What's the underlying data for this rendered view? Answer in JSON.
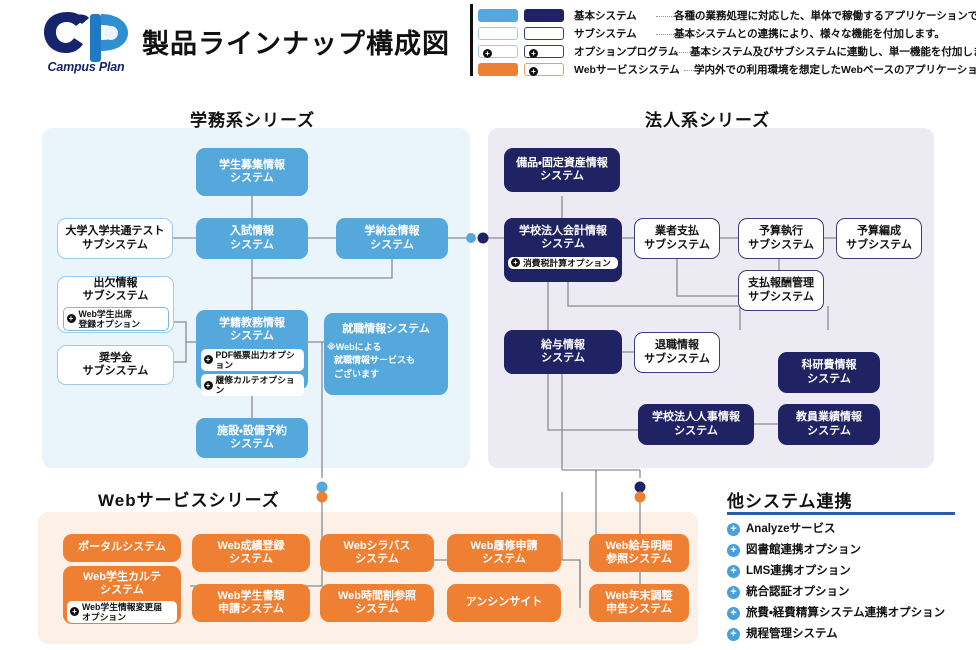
{
  "header": {
    "logo_name": "Campus Plan",
    "logo_icon": "campus-plan-logo",
    "title": "製品ラインナップ構成図"
  },
  "legend": {
    "rows": [
      {
        "label": "基本システム",
        "description": "各種の業務処理に対応した、単体で稼働するアプリケーションです。",
        "swatch1": "#55a8dc",
        "swatch2": "#1f2263",
        "type": "filled"
      },
      {
        "label": "サブシステム",
        "description": "基本システムとの連携により、様々な機能を付加します。",
        "swatch1": "#ffffff",
        "swatch2": "#ffffff",
        "type": "outline"
      },
      {
        "label": "オプションプログラム",
        "description": "基本システム及びサブシステムに連動し、単一機能を付加します。",
        "swatch1": "#ffffff",
        "swatch2": "#ffffff",
        "type": "option",
        "plus": "+"
      },
      {
        "label": "Webサービスシステム",
        "description": "学内外での利用環境を想定したWebベースのアプリケーションです。",
        "swatch1": "#ef8033",
        "swatch2": "#ffffff",
        "type": "web",
        "plus": "+"
      }
    ]
  },
  "sections": {
    "gakumu_caption": "学務系シリーズ",
    "hojin_caption": "法人系シリーズ",
    "web_caption": "Webサービスシリーズ",
    "other_caption": "他システム連携"
  },
  "gakumu": {
    "boxes": [
      {
        "id": "gb1",
        "line1": "学生募集情報",
        "line2": "システム",
        "style": "blue"
      },
      {
        "id": "gb2",
        "line1": "大学入学共通テスト",
        "line2": "サブシステム",
        "style": "sub-blue"
      },
      {
        "id": "gb3",
        "line1": "入試情報",
        "line2": "システム",
        "style": "blue"
      },
      {
        "id": "gb4",
        "line1": "学納金情報",
        "line2": "システム",
        "style": "blue"
      },
      {
        "id": "gb5",
        "line1": "出欠情報",
        "line2": "サブシステム",
        "style": "sub-blue",
        "option": {
          "line1": "Web学生出席",
          "line2": "登録オプション"
        }
      },
      {
        "id": "gb6",
        "line1": "奨学金",
        "line2": "サブシステム",
        "style": "sub-blue"
      },
      {
        "id": "gb7",
        "line1": "学籍教務情報",
        "line2": "システム",
        "style": "blue",
        "options": [
          {
            "text": "PDF帳票出力オプション"
          },
          {
            "text": "履修カルテオプション"
          }
        ]
      },
      {
        "id": "gb8",
        "line1": "就職情報システム",
        "line2": "",
        "style": "blue",
        "note": "※Webによる 就職情報サービスもございます"
      },
      {
        "id": "gb9",
        "line1": "施設・設備予約",
        "line2": "システム",
        "style": "blue"
      }
    ],
    "shushoku_note_l1": "※Webによる",
    "shushoku_note_l2": "就職情報サービスも",
    "shushoku_note_l3": "ございます"
  },
  "hojin": {
    "boxes": [
      {
        "id": "hb1",
        "line1": "備品・固定資産情報",
        "line2": "システム",
        "style": "navy"
      },
      {
        "id": "hb2",
        "line1": "学校法人会計情報",
        "line2": "システム",
        "style": "navy",
        "options": [
          {
            "text": "消費税計算オプション"
          }
        ]
      },
      {
        "id": "hb3",
        "line1": "業者支払",
        "line2": "サブシステム",
        "style": "sub-navy"
      },
      {
        "id": "hb4",
        "line1": "予算執行",
        "line2": "サブシステム",
        "style": "sub-navy"
      },
      {
        "id": "hb5",
        "line1": "予算編成",
        "line2": "サブシステム",
        "style": "sub-navy"
      },
      {
        "id": "hb6",
        "line1": "支払報酬管理",
        "line2": "サブシステム",
        "style": "sub-navy"
      },
      {
        "id": "hb7",
        "line1": "給与情報",
        "line2": "システム",
        "style": "navy"
      },
      {
        "id": "hb8",
        "line1": "退職情報",
        "line2": "サブシステム",
        "style": "sub-navy"
      },
      {
        "id": "hb9",
        "line1": "科研費情報",
        "line2": "システム",
        "style": "navy"
      },
      {
        "id": "hb10",
        "line1": "学校法人人事情報",
        "line2": "システム",
        "style": "navy"
      },
      {
        "id": "hb11",
        "line1": "教員業績情報",
        "line2": "システム",
        "style": "navy"
      }
    ]
  },
  "web": {
    "boxes": [
      {
        "id": "wb1",
        "line1": "ポータルシステム",
        "line2": "",
        "style": "orange"
      },
      {
        "id": "wb2",
        "line1": "Web学生カルテ",
        "line2": "システム",
        "style": "orange",
        "option": {
          "line1": "Web学生情報変更届",
          "line2": "オプション"
        }
      },
      {
        "id": "wb3",
        "line1": "Web成績登録",
        "line2": "システム",
        "style": "orange"
      },
      {
        "id": "wb4",
        "line1": "Web学生書類",
        "line2": "申請システム",
        "style": "orange"
      },
      {
        "id": "wb5",
        "line1": "Webシラバス",
        "line2": "システム",
        "style": "orange"
      },
      {
        "id": "wb6",
        "line1": "Web時間割参照",
        "line2": "システム",
        "style": "orange"
      },
      {
        "id": "wb7",
        "line1": "Web履修申請",
        "line2": "システム",
        "style": "orange"
      },
      {
        "id": "wb8",
        "line1": "アンシンサイト",
        "line2": "",
        "style": "orange"
      },
      {
        "id": "wb9",
        "line1": "Web給与明細",
        "line2": "参照システム",
        "style": "orange"
      },
      {
        "id": "wb10",
        "line1": "Web年末調整",
        "line2": "申告システム",
        "style": "orange"
      }
    ]
  },
  "other_systems": {
    "items": [
      {
        "label": "Analyzeサービス"
      },
      {
        "label": "図書館連携オプション"
      },
      {
        "label": "LMS連携オプション"
      },
      {
        "label": "統合認証オプション"
      },
      {
        "label": "旅費・経費精算システム連携オプション"
      },
      {
        "label": "規程管理システム"
      }
    ]
  },
  "colors": {
    "blue": "#55a8dc",
    "navy": "#1f2263",
    "orange": "#ef8033",
    "panel_blue": "#eaf4fb",
    "panel_purple": "#eceaf2",
    "panel_orange": "#fdf0e6",
    "rule": "#2a5ea8",
    "wire": "#8a8a93"
  }
}
